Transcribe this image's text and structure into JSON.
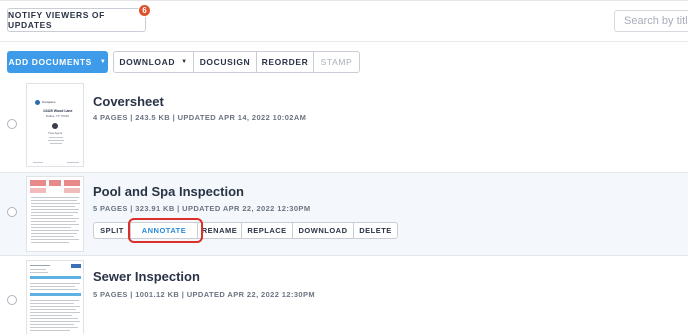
{
  "header": {
    "notify_label": "NOTIFY VIEWERS OF UPDATES",
    "notify_count": "6",
    "search_placeholder": "Search by title"
  },
  "toolbar": {
    "add_label": "ADD DOCUMENTS",
    "download_label": "DOWNLOAD",
    "docusign_label": "DOCUSIGN",
    "reorder_label": "REORDER",
    "stamp_label": "STAMP"
  },
  "documents": [
    {
      "title": "Coversheet",
      "meta": "4 PAGES | 243.5 KB | UPDATED APR 14, 2022 10:02AM",
      "thumb": {
        "brand": "Compass",
        "address": "13425 Wood Lane",
        "city": "Dallas, TX 75230",
        "agent": "Tina Agent"
      }
    },
    {
      "title": "Pool and Spa Inspection",
      "meta": "5 PAGES | 323.91 KB | UPDATED APR 22, 2022 12:30PM",
      "actions": {
        "split": "SPLIT",
        "annotate": "ANNOTATE",
        "rename": "RENAME",
        "replace": "REPLACE",
        "download": "DOWNLOAD",
        "delete": "DELETE"
      }
    },
    {
      "title": "Sewer Inspection",
      "meta": "5 PAGES | 1001.12 KB | UPDATED APR 22, 2022 12:30PM"
    }
  ],
  "colors": {
    "accent": "#3d9be9",
    "badge": "#e0522b",
    "highlight": "#d9302a",
    "selected_row": "#f4f8fc"
  },
  "icons": {
    "dropdown": "chevron-down-icon"
  }
}
